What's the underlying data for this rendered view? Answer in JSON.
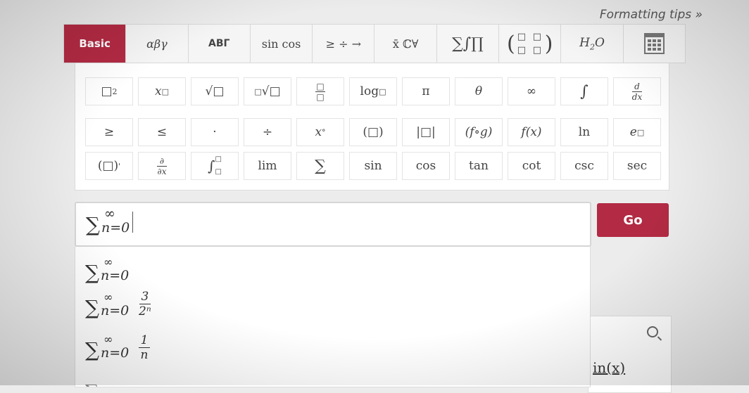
{
  "formatting_tips": "Formatting tips »",
  "tabs": [
    {
      "label": "Basic",
      "active": true
    },
    {
      "label": "αβγ"
    },
    {
      "label": "ΑΒΓ"
    },
    {
      "label": "sin cos"
    },
    {
      "label": "≥ ÷ →"
    },
    {
      "label": "x̄ ℂ∀"
    },
    {
      "label": "∑∫∏"
    },
    {
      "label": "(⁰⁰ ⁰⁰)"
    },
    {
      "label": "H₂O"
    },
    {
      "label": "calculator"
    }
  ],
  "symbols": {
    "row1": [
      "□²",
      "x□",
      "√□",
      "∛□",
      "□/□",
      "log□",
      "π",
      "θ",
      "∞",
      "∫",
      "d/dx"
    ],
    "row2": [
      "≥",
      "≤",
      "·",
      "÷",
      "x°",
      "(□)",
      "|□|",
      "(f∘g)",
      "f(x)",
      "ln",
      "e□"
    ],
    "row3": [
      "(□)'",
      "∂/∂x",
      "∫□□",
      "lim",
      "∑",
      "sin",
      "cos",
      "tan",
      "cot",
      "csc",
      "sec"
    ]
  },
  "input": {
    "sigma": "∑",
    "upper": "∞",
    "lower": "n=0"
  },
  "go_label": "Go",
  "suggestions": [
    {
      "upper": "∞",
      "lower": "n=0",
      "num": "",
      "den": ""
    },
    {
      "upper": "∞",
      "lower": "n=0",
      "num": "3",
      "den": "2ⁿ"
    },
    {
      "upper": "∞",
      "lower": "n=0",
      "num": "1",
      "den": "n"
    }
  ],
  "background_link": "in(x)",
  "colors": {
    "accent": "#b22a43"
  }
}
